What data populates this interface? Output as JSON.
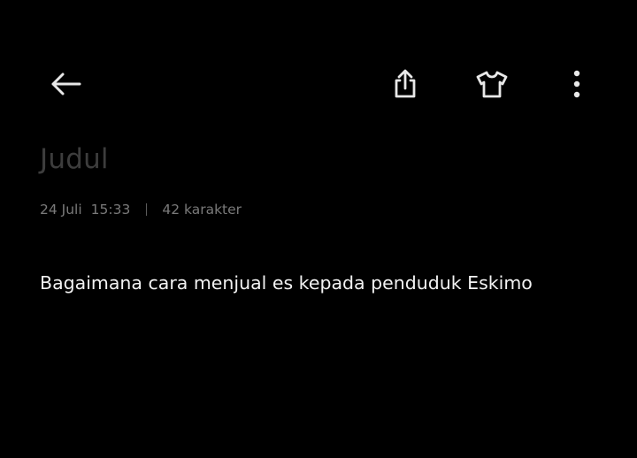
{
  "toolbar": {
    "back_icon": "arrow-left-icon",
    "share_icon": "share-icon",
    "theme_icon": "shirt-icon",
    "more_icon": "more-vertical-icon"
  },
  "note": {
    "title_placeholder": "Judul",
    "date": "24 Juli",
    "time": "15:33",
    "char_count": "42 karakter",
    "content": "Bagaimana cara menjual es kepada penduduk Eskimo"
  },
  "colors": {
    "background": "#000000",
    "icon": "#e8e8e8",
    "title_placeholder": "#3d3d3d",
    "meta": "#7a7a7a",
    "content": "#f2f2f2"
  }
}
